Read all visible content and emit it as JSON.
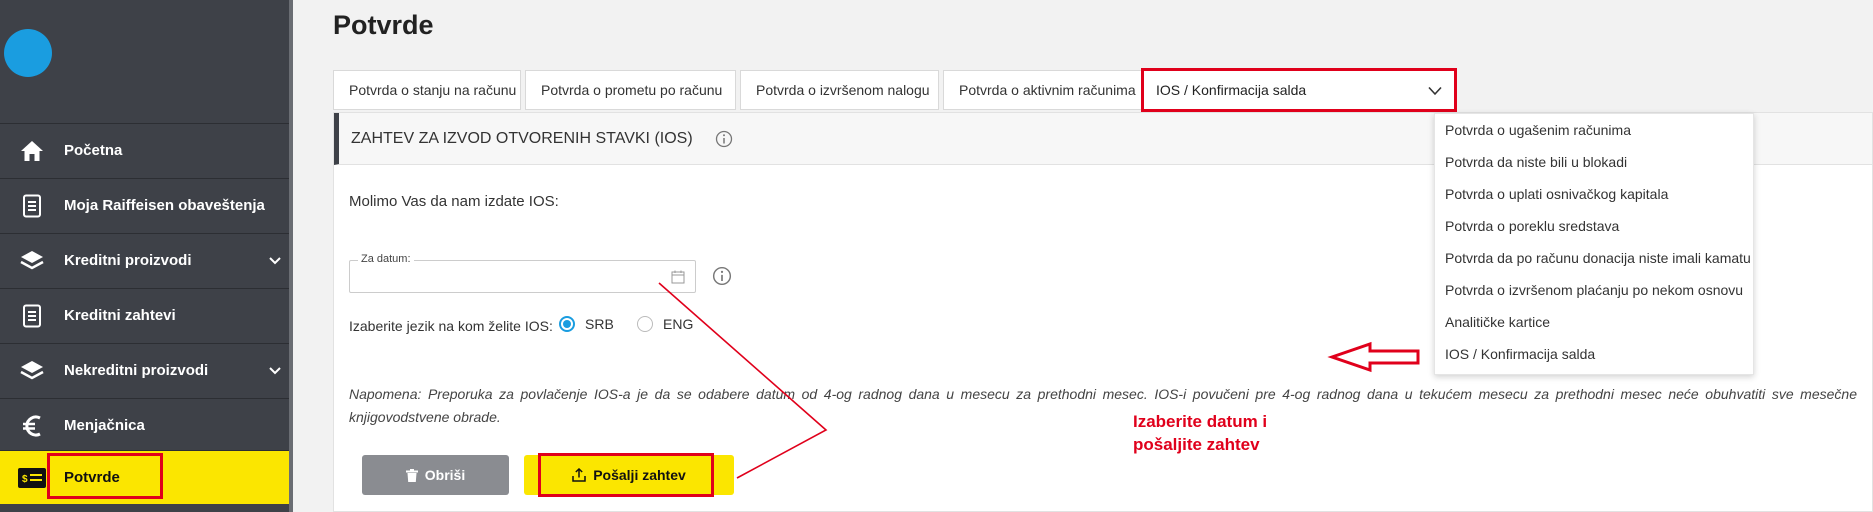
{
  "sidebar": {
    "items": [
      {
        "label": "Početna",
        "icon": "home-icon"
      },
      {
        "label": "Moja Raiffeisen obaveštenja",
        "icon": "document-icon"
      },
      {
        "label": "Kreditni proizvodi",
        "icon": "layers-icon",
        "expandable": true
      },
      {
        "label": "Kreditni zahtevi",
        "icon": "document-icon"
      },
      {
        "label": "Nekreditni proizvodi",
        "icon": "layers-icon",
        "expandable": true
      },
      {
        "label": "Menjačnica",
        "icon": "euro-icon"
      },
      {
        "label": "Potvrde",
        "icon": "cash-card-icon",
        "active": true
      }
    ]
  },
  "page": {
    "title": "Potvrde"
  },
  "tabs": [
    "Potvrda o stanju na računu",
    "Potvrda o prometu po računu",
    "Potvrda o izvršenom nalogu",
    "Potvrda o aktivnim računima"
  ],
  "tab_select": {
    "value": "IOS / Konfirmacija salda"
  },
  "dropdown": {
    "options": [
      "Potvrda o ugašenim računima",
      "Potvrda da niste bili u blokadi",
      "Potvrda o uplati osnivačkog kapitala",
      "Potvrda o poreklu sredstava",
      "Potvrda da po računu donacija niste imali kamatu",
      "Potvrda o izvršenom plaćanju po nekom osnovu",
      "Analitičke kartice",
      "IOS / Konfirmacija salda"
    ]
  },
  "form": {
    "heading": "ZAHTEV ZA IZVOD OTVORENIH STAVKI (IOS)",
    "intro": "Molimo Vas da nam izdate IOS:",
    "date_label": "Za datum:",
    "language_label": "Izaberite jezik na kom želite IOS:",
    "language_options": [
      "SRB",
      "ENG"
    ],
    "language_selected": "SRB",
    "note": "Napomena: Preporuka za povlačenje IOS-a je da se odabere datum od 4-og radnog dana u mesecu za prethodni mesec. IOS-i povučeni pre 4-og radnog dana u tekućem mesecu za prethodni mesec neće obuhvatiti sve mesečne knjigovodstvene obrade.",
    "clear_label": "Obriši",
    "send_label": "Pošalji zahtev"
  },
  "annotation": {
    "line1": "Izaberite datum i",
    "line2": "pošaljite zahtev"
  },
  "colors": {
    "sidebar_bg": "#3e4148",
    "active_yellow": "#fbe600",
    "accent_blue": "#1a9de0",
    "annotation_red": "#e0001b"
  }
}
